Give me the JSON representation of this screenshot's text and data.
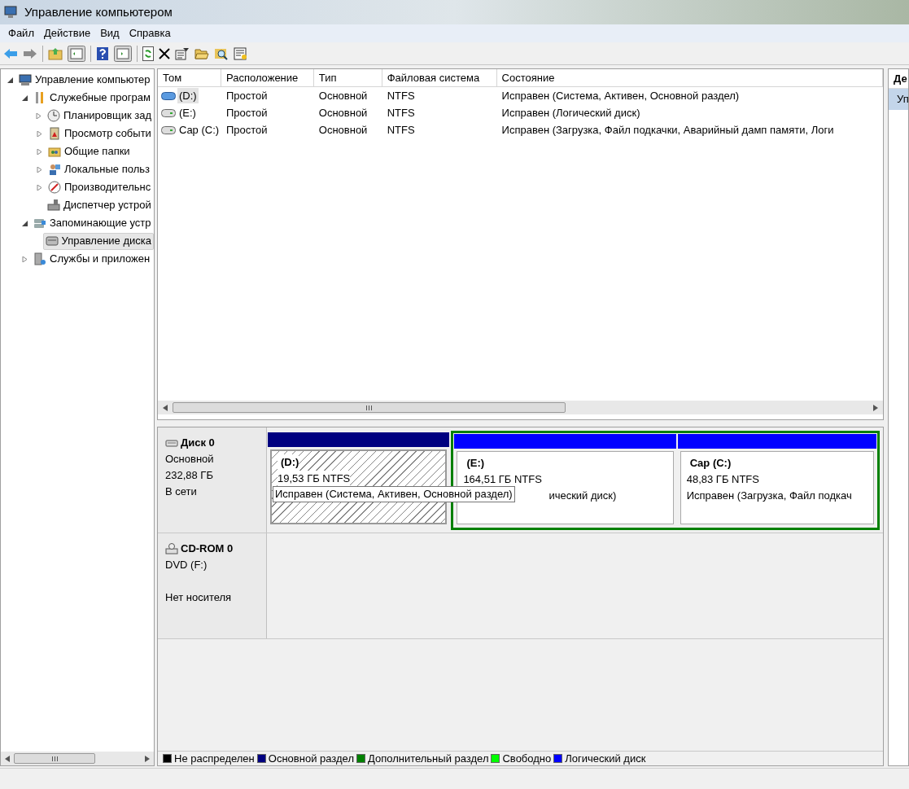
{
  "window": {
    "title": "Управление компьютером"
  },
  "menu": [
    "Файл",
    "Действие",
    "Вид",
    "Справка"
  ],
  "tree": [
    {
      "label": "Управление компьютер",
      "kind": "computer",
      "selected": false,
      "expanded": true,
      "children": [
        {
          "label": "Служебные програм",
          "kind": "tools",
          "selected": false,
          "expanded": true,
          "children": [
            {
              "label": "Планировщик зад",
              "kind": "clock",
              "selected": false,
              "expanded": false
            },
            {
              "label": "Просмотр событи",
              "kind": "log",
              "selected": false,
              "expanded": false
            },
            {
              "label": "Общие папки",
              "kind": "folder",
              "selected": false,
              "expanded": false
            },
            {
              "label": "Локальные польз",
              "kind": "users",
              "selected": false,
              "expanded": false
            },
            {
              "label": "Производительнс",
              "kind": "gauge",
              "selected": false,
              "expanded": false
            },
            {
              "label": "Диспетчер устрой",
              "kind": "device",
              "selected": false
            }
          ]
        },
        {
          "label": "Запоминающие устр",
          "kind": "storage",
          "selected": false,
          "expanded": true,
          "children": [
            {
              "label": "Управление диска",
              "kind": "disk",
              "selected": true
            }
          ]
        },
        {
          "label": "Службы и приложен",
          "kind": "services",
          "selected": false,
          "expanded": false
        }
      ]
    }
  ],
  "table": {
    "columns": [
      "Том",
      "Расположение",
      "Тип",
      "Файловая система",
      "Состояние"
    ],
    "rows": [
      {
        "cells": [
          "(D:)",
          "Простой",
          "Основной",
          "NTFS",
          "Исправен (Система, Активен, Основной раздел)"
        ],
        "selected": true,
        "primary": true
      },
      {
        "cells": [
          "(E:)",
          "Простой",
          "Основной",
          "NTFS",
          "Исправен (Логический диск)"
        ],
        "selected": false,
        "primary": false
      },
      {
        "cells": [
          "Cap (C:)",
          "Простой",
          "Основной",
          "NTFS",
          "Исправен (Загрузка, Файл подкачки, Аварийный дамп памяти, Логи"
        ],
        "selected": false,
        "primary": false
      }
    ]
  },
  "disks": [
    {
      "kind": "disk",
      "name": "Диск 0",
      "lines": [
        "Основной",
        "232,88 ГБ",
        "В сети"
      ],
      "partitions": [
        {
          "name": "(D:)",
          "size": "19,53 ГБ NTFS",
          "kind": "primary",
          "extended": false,
          "selected": true
        },
        {
          "name": "(E:)",
          "size": "164,51 ГБ NTFS",
          "status": "ический диск)",
          "kind": "logical",
          "extended": true,
          "selected": false
        },
        {
          "name": "Cap  (C:)",
          "size": "48,83 ГБ NTFS",
          "status": "Исправен (Загрузка, Файл подкач",
          "kind": "logical",
          "extended": true,
          "selected": false
        }
      ]
    },
    {
      "kind": "cdrom",
      "name": "CD-ROM 0",
      "lines": [
        "DVD (F:)",
        "Нет носителя"
      ]
    }
  ],
  "tooltip": "Исправен (Система, Активен, Основной раздел)",
  "legend": [
    {
      "label": "Не распределен",
      "color": "#000000"
    },
    {
      "label": "Основной раздел",
      "color": "#000080"
    },
    {
      "label": "Дополнительный раздел",
      "color": "#008000"
    },
    {
      "label": "Свободно",
      "color": "#00ff00"
    },
    {
      "label": "Логический диск",
      "color": "#0000ff"
    }
  ],
  "actions": {
    "header": "Де",
    "items": [
      {
        "label": "Уп",
        "selected": true
      }
    ]
  }
}
